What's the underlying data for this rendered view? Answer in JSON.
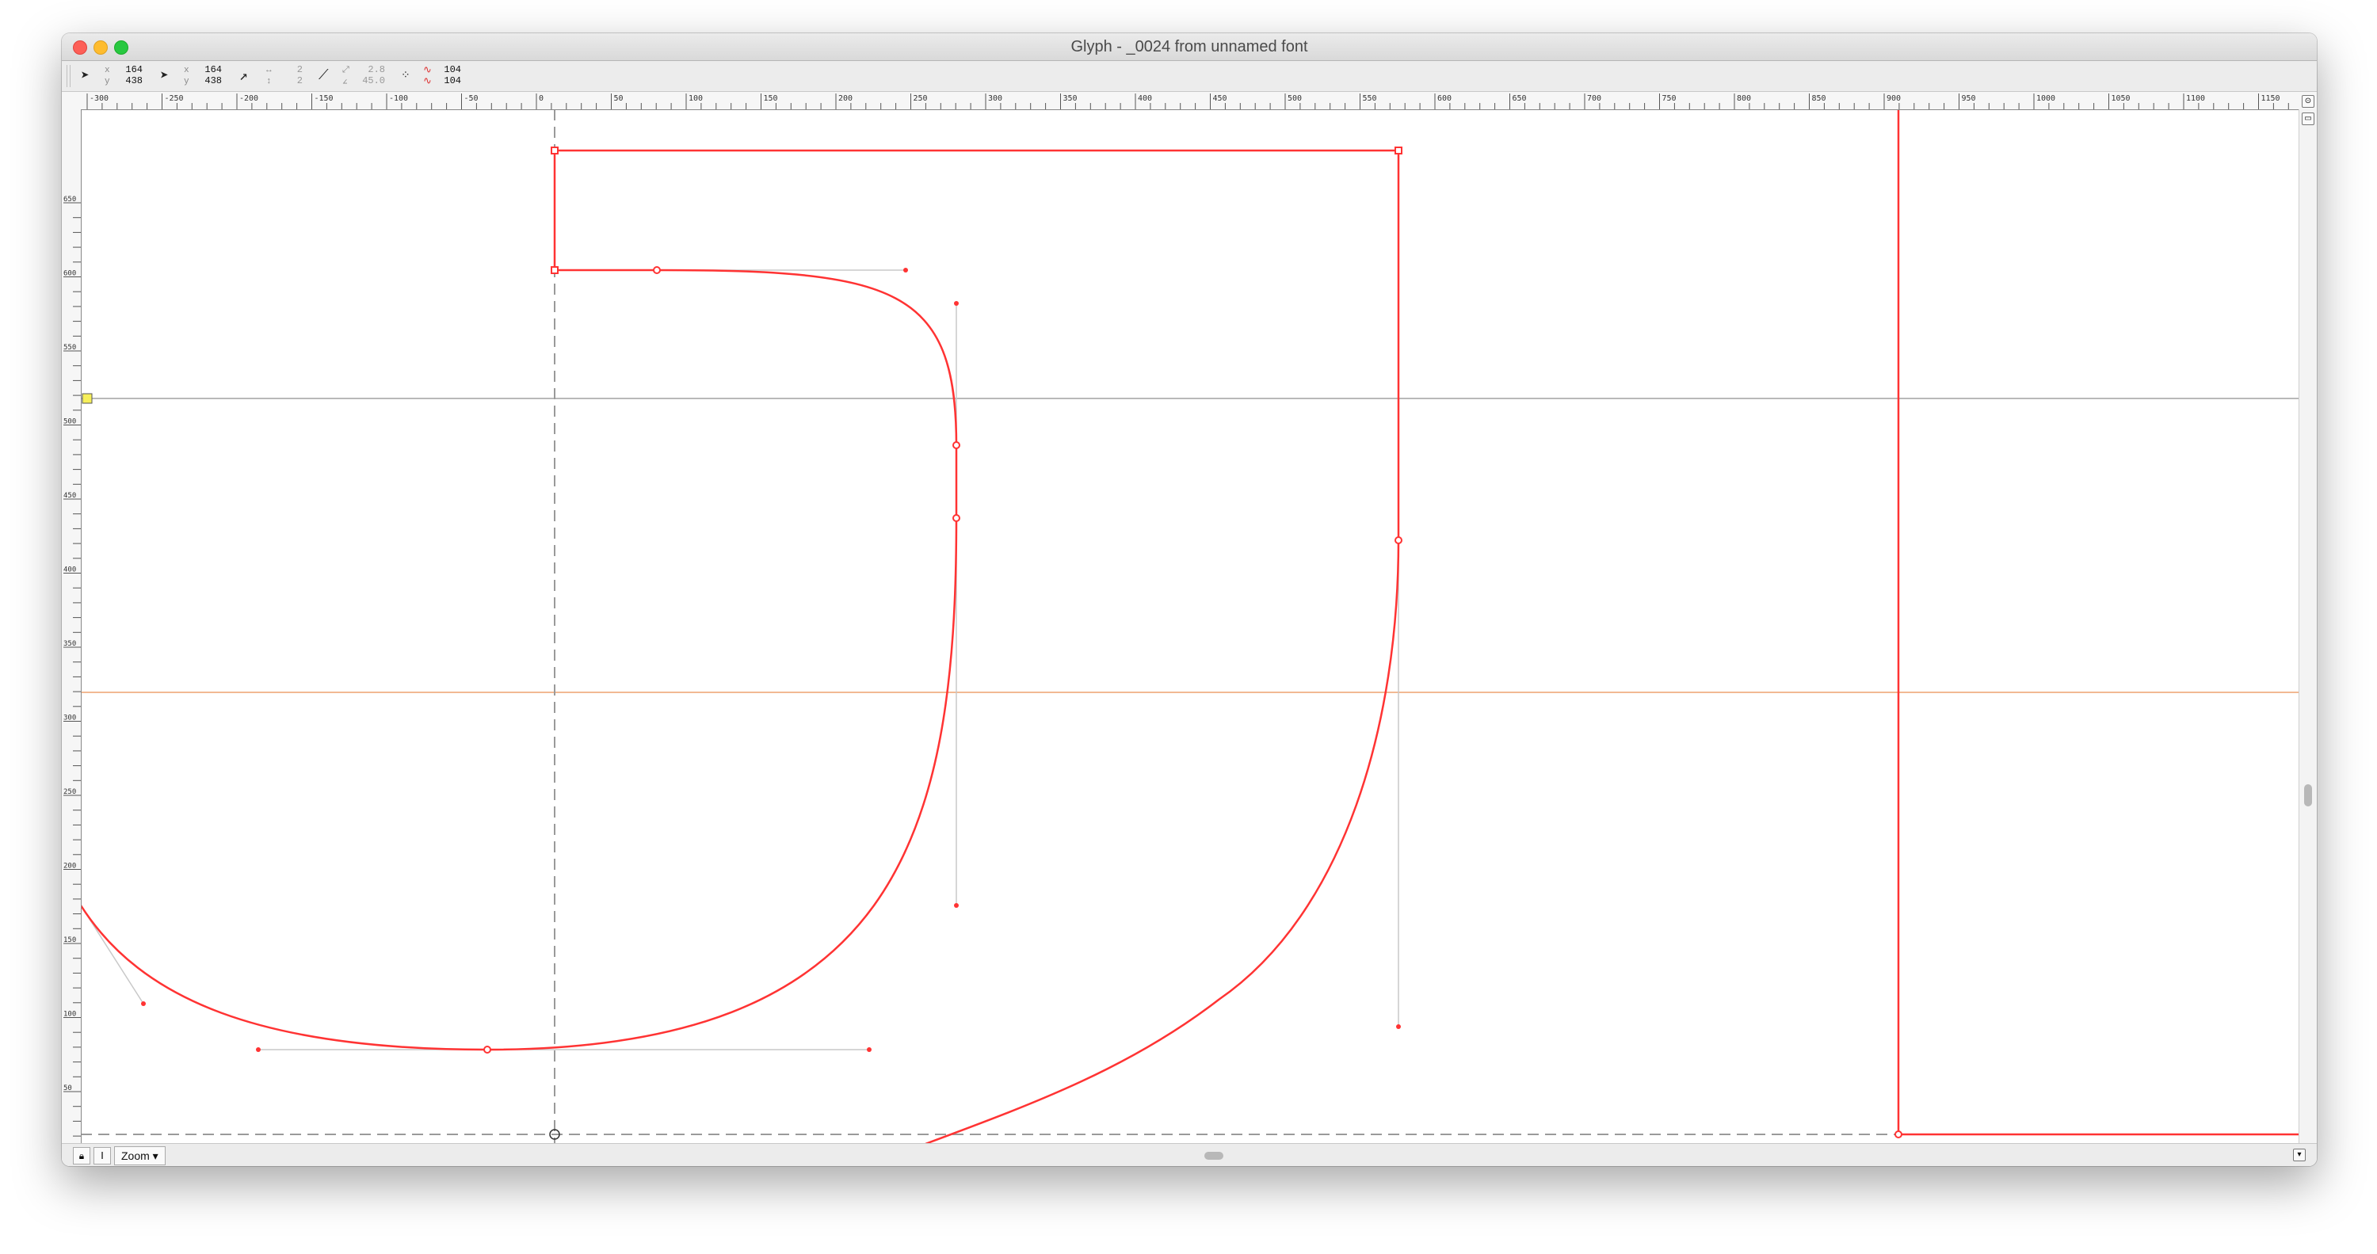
{
  "window": {
    "title": "Glyph - _0024 from unnamed font"
  },
  "toolbar": {
    "pointer": {
      "x_label": "x",
      "y_label": "y",
      "x": "164",
      "y": "438"
    },
    "point_tool": {
      "x_label": "x",
      "y_label": "y",
      "x": "164",
      "y": "438"
    },
    "delta": {
      "dx": "2",
      "dy": "2"
    },
    "angle": {
      "distance": "2.8",
      "angle": "45.0"
    },
    "count": {
      "top": "104",
      "bottom": "104"
    }
  },
  "rulers": {
    "top_ticks": [
      "-300",
      "-250",
      "-200",
      "-150",
      "-100",
      "-50",
      "0",
      "50",
      "100",
      "150",
      "200",
      "250",
      "300",
      "350",
      "400",
      "450",
      "500",
      "550",
      "600",
      "650",
      "700",
      "750",
      "800",
      "850",
      "900",
      "950",
      "1000",
      "1050",
      "1100",
      "1150"
    ],
    "left_ticks": [
      "650",
      "600",
      "550",
      "500",
      "450",
      "400",
      "350",
      "300",
      "250",
      "200",
      "150",
      "100",
      "50"
    ]
  },
  "bottom": {
    "zoom_label": "Zoom ▾",
    "lock_icon": "lock-icon",
    "ibeam_icon": "ibeam-icon"
  },
  "colors": {
    "contour": "#ff3333",
    "baseline_guide": "#999999",
    "ascent_guide": "#bbbbbb",
    "xheight_guide": "#f0b48c"
  }
}
